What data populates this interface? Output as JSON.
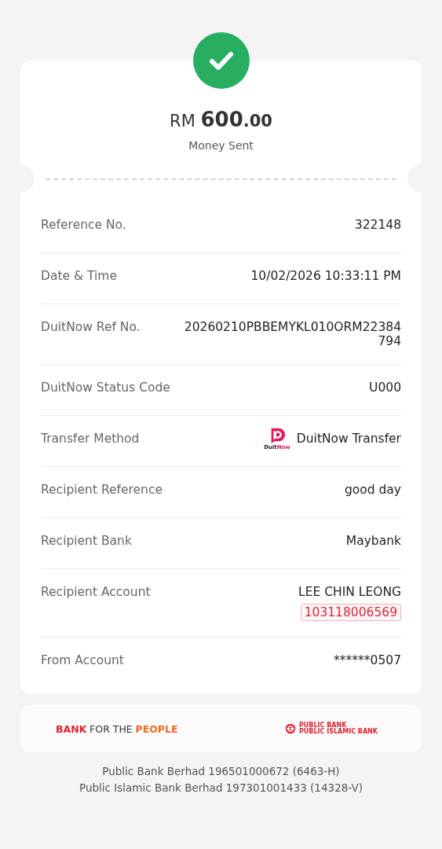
{
  "amount": {
    "currency": "RM",
    "whole": "600",
    "cents": ".00"
  },
  "status": "Money Sent",
  "rows": [
    {
      "kind": "text",
      "label": "Reference No.",
      "value": "322148"
    },
    {
      "kind": "text",
      "label": "Date & Time",
      "value": "10/02/2026 10:33:11 PM"
    },
    {
      "kind": "lines",
      "label": "DuitNow Ref No.",
      "lines": [
        "20260210PBBEMYKL010ORM22384",
        "794"
      ]
    },
    {
      "kind": "text",
      "label": "DuitNow Status Code",
      "value": "U000"
    },
    {
      "kind": "method",
      "label": "Transfer Method",
      "logo_text": [
        "Duit",
        "Now"
      ],
      "value": "DuitNow Transfer"
    },
    {
      "kind": "text",
      "label": "Recipient Reference",
      "value": "good day"
    },
    {
      "kind": "text",
      "label": "Recipient Bank",
      "value": "Maybank"
    },
    {
      "kind": "account",
      "label": "Recipient Account",
      "value": "LEE CHIN LEONG",
      "account": "103118006569"
    },
    {
      "kind": "text",
      "label": "From Account",
      "value": "******0507"
    }
  ],
  "tagline": [
    {
      "text": "BANK",
      "color": "#e3212f"
    },
    {
      "text": "FOR THE",
      "color": "#333333"
    },
    {
      "text": "PEOPLE",
      "color": "#f26a21"
    }
  ],
  "bank_logo": [
    "PUBLIC BANK",
    "PUBLIC ISLAMIC BANK"
  ],
  "footer": [
    "Public Bank Berhad 196501000672 (6463-H)",
    "Public Islamic Bank Berhad 197301001433 (14328-V)"
  ]
}
